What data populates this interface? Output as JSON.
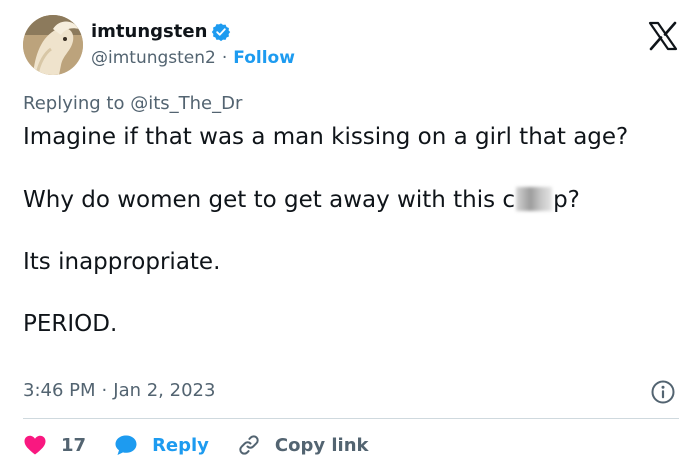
{
  "author": {
    "display_name": "imtungsten",
    "handle": "@imtungsten2",
    "separator": "·",
    "follow_label": "Follow"
  },
  "reply_context": "Replying to @its_The_Dr",
  "tweet": {
    "line1": "Imagine if that was a man kissing on a girl that age?",
    "line2_prefix": "Why do women get to get away with this c",
    "line2_suffix": "p?",
    "line3": "Its inappropriate.",
    "line4": "PERIOD."
  },
  "meta": {
    "time": "3:46 PM",
    "separator": "·",
    "date": "Jan 2, 2023"
  },
  "actions": {
    "like_count": "17",
    "reply_label": "Reply",
    "copy_link_label": "Copy link"
  },
  "colors": {
    "accent": "#1d9bf0",
    "like": "#f91880",
    "muted": "#536471",
    "text": "#0f1419"
  },
  "icons": [
    "verified-badge-icon",
    "x-logo-icon",
    "info-icon",
    "heart-icon",
    "reply-bubble-icon",
    "link-icon"
  ]
}
